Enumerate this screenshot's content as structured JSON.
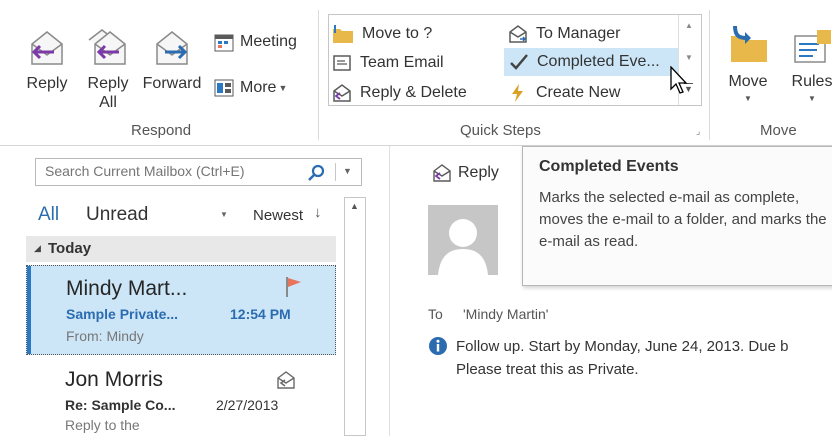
{
  "respond": {
    "reply": "Reply",
    "reply_all": "Reply All",
    "forward": "Forward",
    "meeting": "Meeting",
    "more": "More",
    "group_label": "Respond"
  },
  "quick_steps": {
    "move_to": "Move to ?",
    "to_manager": "To Manager",
    "team_email": "Team Email",
    "completed_events": "Completed Eve...",
    "reply_delete": "Reply & Delete",
    "create_new": "Create New",
    "group_label": "Quick Steps"
  },
  "move": {
    "move": "Move",
    "rules": "Rules",
    "group_label": "Move"
  },
  "search": {
    "placeholder": "Search Current Mailbox (Ctrl+E)"
  },
  "filters": {
    "all": "All",
    "unread": "Unread",
    "sort": "Newest"
  },
  "list": {
    "group_header": "Today",
    "items": [
      {
        "sender": "Mindy Mart...",
        "subject": "Sample Private...",
        "time": "12:54 PM",
        "preview": "From: Mindy"
      },
      {
        "sender": "Jon Morris",
        "subject": "Re: Sample Co...",
        "time": "2/27/2013",
        "preview": "Reply to the"
      }
    ]
  },
  "reading": {
    "reply": "Reply",
    "to_label": "To",
    "to_value": "'Mindy Martin'",
    "info_line1": "Follow up.  Start by Monday, June 24, 2013.  Due b",
    "info_line2": "Please treat this as Private."
  },
  "tooltip": {
    "title": "Completed Events",
    "body": "Marks the selected e-mail as complete, moves the e-mail to a folder, and marks the e-mail as read."
  },
  "colors": {
    "accent": "#2b79c2",
    "selected": "#cde6f7",
    "flag": "#e8745d",
    "envelope_purple": "#7b3aa8",
    "folder_yellow": "#e8b94a"
  }
}
